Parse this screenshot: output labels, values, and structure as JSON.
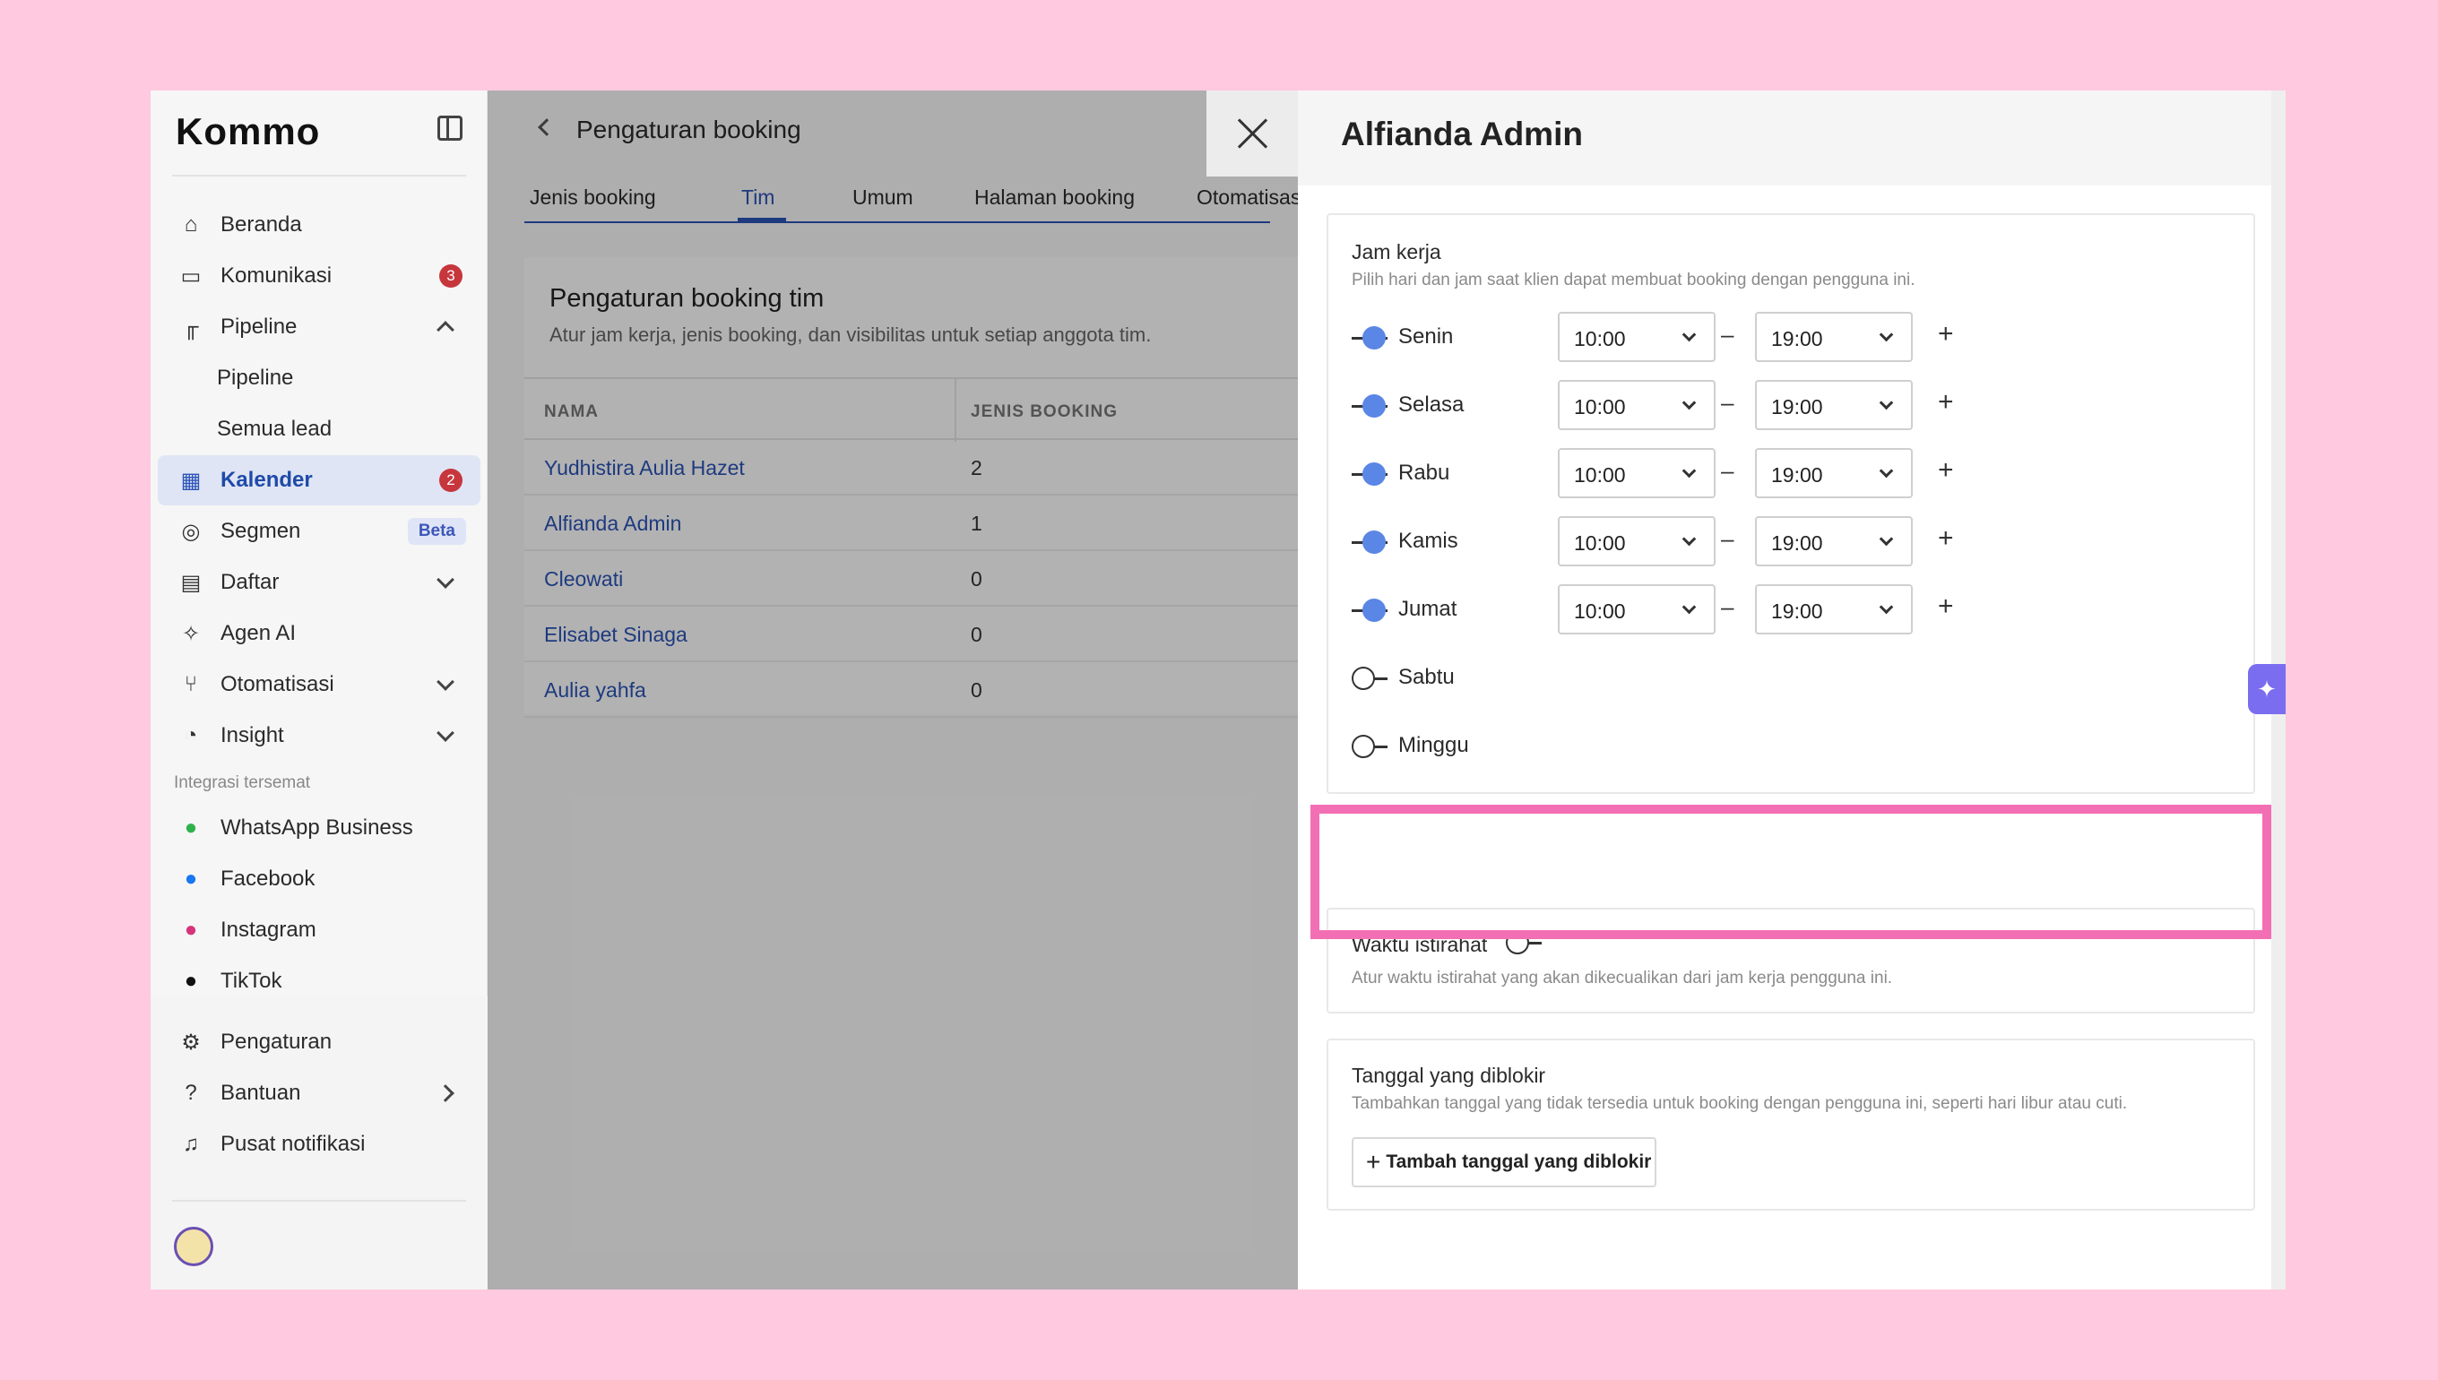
{
  "brand": {
    "logo": "Kommo"
  },
  "sidebar": {
    "items": [
      {
        "label": "Beranda",
        "icon": "home-icon"
      },
      {
        "label": "Komunikasi",
        "icon": "chat-icon",
        "badge": "3"
      },
      {
        "label": "Pipeline",
        "icon": "pipeline-icon"
      },
      {
        "label": "Pipeline"
      },
      {
        "label": "Semua lead"
      },
      {
        "label": "Kalender",
        "icon": "calendar-icon",
        "badge": "2"
      },
      {
        "label": "Segmen",
        "icon": "segment-icon",
        "badge": "Beta"
      },
      {
        "label": "Daftar",
        "icon": "list-icon"
      },
      {
        "label": "Agen AI",
        "icon": "sparkle-icon"
      },
      {
        "label": "Otomatisasi",
        "icon": "automation-icon"
      },
      {
        "label": "Insight",
        "icon": "chart-icon"
      }
    ],
    "section_label": "Integrasi tersemat",
    "integrations": [
      {
        "label": "WhatsApp Business",
        "icon": "whatsapp-icon"
      },
      {
        "label": "Facebook",
        "icon": "facebook-icon"
      },
      {
        "label": "Instagram",
        "icon": "instagram-icon"
      },
      {
        "label": "TikTok",
        "icon": "tiktok-icon"
      }
    ],
    "bottom": [
      {
        "label": "Pengaturan",
        "icon": "gear-icon"
      },
      {
        "label": "Bantuan",
        "icon": "help-icon"
      },
      {
        "label": "Pusat notifikasi",
        "icon": "bell-icon"
      }
    ]
  },
  "main": {
    "title": "Pengaturan booking",
    "tabs": [
      {
        "label": "Jenis booking"
      },
      {
        "label": "Tim"
      },
      {
        "label": "Umum"
      },
      {
        "label": "Halaman booking"
      },
      {
        "label": "Otomatisasi"
      }
    ],
    "active_tab": "Tim",
    "team": {
      "title": "Pengaturan booking tim",
      "description": "Atur jam kerja, jenis booking, dan visibilitas untuk setiap anggota tim.",
      "columns": [
        "NAMA",
        "JENIS BOOKING"
      ],
      "rows": [
        {
          "name": "Yudhistira Aulia Hazet",
          "count": "2"
        },
        {
          "name": "Alfianda Admin",
          "count": "1"
        },
        {
          "name": "Cleowati",
          "count": "0"
        },
        {
          "name": "Elisabet Sinaga",
          "count": "0"
        },
        {
          "name": "Aulia yahfa",
          "count": "0"
        }
      ]
    }
  },
  "panel": {
    "title": "Alfianda Admin",
    "work_hours": {
      "title": "Jam kerja",
      "description": "Pilih hari dan jam saat klien dapat membuat booking dengan pengguna ini.",
      "dash": "–",
      "plus": "+",
      "days": [
        {
          "label": "Senin",
          "enabled": true,
          "start": "10:00",
          "end": "19:00"
        },
        {
          "label": "Selasa",
          "enabled": true,
          "start": "10:00",
          "end": "19:00"
        },
        {
          "label": "Rabu",
          "enabled": true,
          "start": "10:00",
          "end": "19:00"
        },
        {
          "label": "Kamis",
          "enabled": true,
          "start": "10:00",
          "end": "19:00"
        },
        {
          "label": "Jumat",
          "enabled": true,
          "start": "10:00",
          "end": "19:00"
        },
        {
          "label": "Sabtu",
          "enabled": false
        },
        {
          "label": "Minggu",
          "enabled": false
        }
      ]
    },
    "break": {
      "title": "Waktu istirahat",
      "enabled": false,
      "description": "Atur waktu istirahat yang akan dikecualikan dari jam kerja pengguna ini."
    },
    "blocked": {
      "title": "Tanggal yang diblokir",
      "description": "Tambahkan tanggal yang tidak tersedia untuk booking dengan pengguna ini, seperti hari libur atau cuti.",
      "button": "Tambah tanggal yang diblokir"
    }
  },
  "colors": {
    "accent": "#2c54b7",
    "toggle_on": "#5a86e6",
    "highlight": "#f36fb4",
    "background": "#ffc9df"
  }
}
